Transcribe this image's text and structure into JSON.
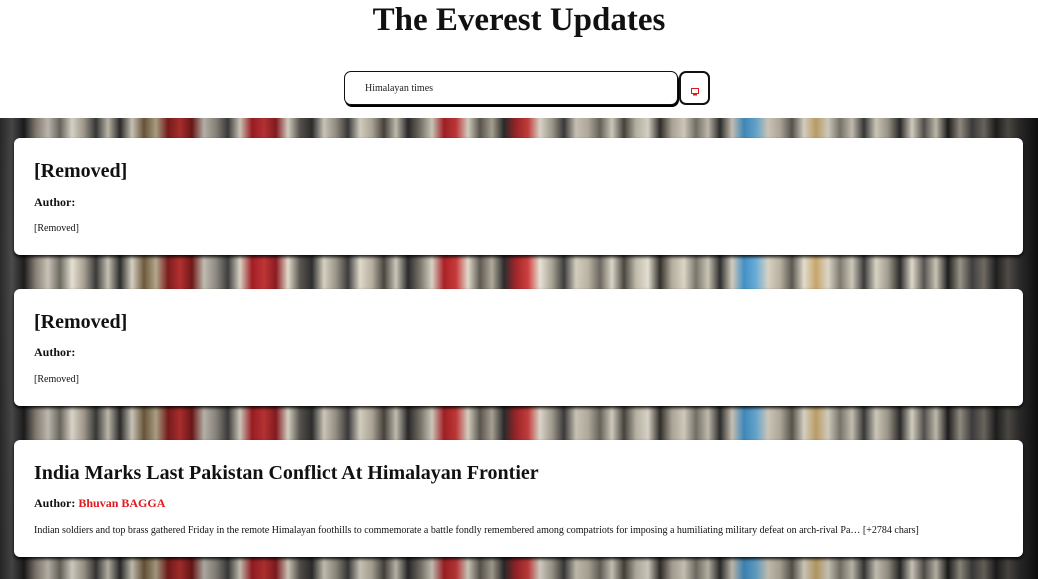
{
  "site": {
    "title": "The Everest Updates"
  },
  "search": {
    "value": "Himalayan times",
    "button_icon": "search-icon"
  },
  "articles": [
    {
      "title": "[Removed]",
      "author_label": "Author:",
      "author": "",
      "body": "[Removed]"
    },
    {
      "title": "[Removed]",
      "author_label": "Author:",
      "author": "",
      "body": "[Removed]"
    },
    {
      "title": "India Marks Last Pakistan Conflict At Himalayan Frontier",
      "author_label": "Author:",
      "author": "Bhuvan BAGGA",
      "body": "Indian soldiers and top brass gathered Friday in the remote Himalayan foothills to commemorate a battle fondly remembered among compatriots for imposing a humiliating military defeat on arch-rival Pa… [+2784 chars]"
    }
  ],
  "colors": {
    "author_name": "#e0191e",
    "search_icon": "#e0191e"
  }
}
